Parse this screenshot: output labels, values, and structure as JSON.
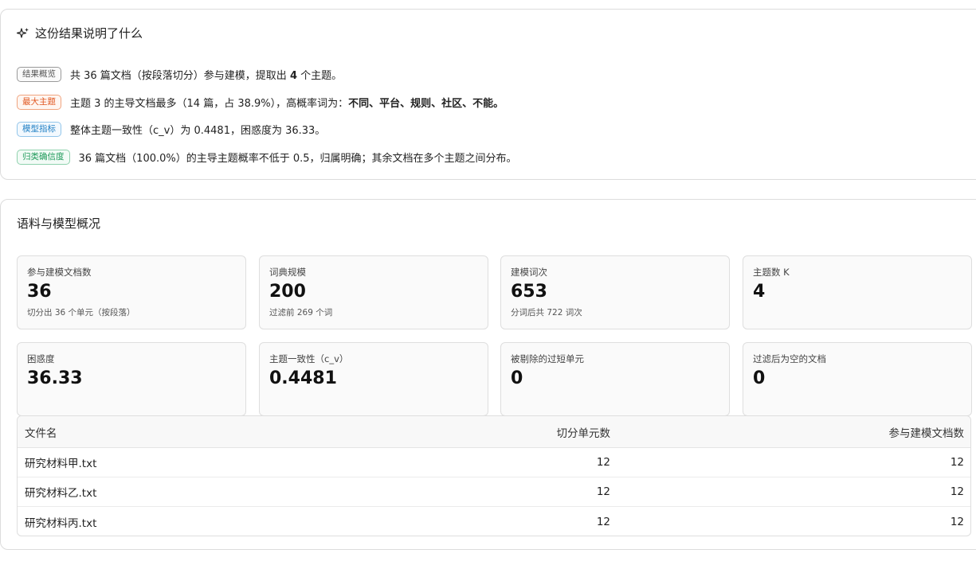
{
  "summary": {
    "title": "这份结果说明了什么",
    "icon": "sparkle-icon",
    "lines": [
      {
        "badge": "结果概览",
        "text_a": "共 36 篇文档（按段落切分）参与建模，提取出 ",
        "bold": "4",
        "text_b": " 个主题。"
      },
      {
        "badge": "最大主题",
        "text_a": "主题 3 的主导文档最多（14 篇，占 38.9%），高概率词为：",
        "bold": "不同、平台、规则、社区、不能。",
        "text_b": ""
      },
      {
        "badge": "模型指标",
        "text_a": "整体主题一致性（c_v）为 0.4481，困惑度为 36.33。",
        "bold": "",
        "text_b": ""
      },
      {
        "badge": "归类确信度",
        "text_a": "36 篇文档（100.0%）的主导主题概率不低于 0.5，归属明确；其余文档在多个主题之间分布。",
        "bold": "",
        "text_b": ""
      }
    ]
  },
  "overview": {
    "title": "语料与模型概况",
    "metrics": [
      {
        "label": "参与建模文档数",
        "value": "36",
        "sub": "切分出 36 个单元（按段落）"
      },
      {
        "label": "词典规模",
        "value": "200",
        "sub": "过滤前 269 个词"
      },
      {
        "label": "建模词次",
        "value": "653",
        "sub": "分词后共 722 词次"
      },
      {
        "label": "主题数 K",
        "value": "4",
        "sub": ""
      },
      {
        "label": "困惑度",
        "value": "36.33",
        "sub": ""
      },
      {
        "label": "主题一致性（c_v）",
        "value": "0.4481",
        "sub": ""
      },
      {
        "label": "被剔除的过短单元",
        "value": "0",
        "sub": ""
      },
      {
        "label": "过滤后为空的文档",
        "value": "0",
        "sub": ""
      }
    ],
    "table": {
      "headers": [
        "文件名",
        "切分单元数",
        "参与建模文档数"
      ],
      "rows": [
        [
          "研究材料甲.txt",
          "12",
          "12"
        ],
        [
          "研究材料乙.txt",
          "12",
          "12"
        ],
        [
          "研究材料丙.txt",
          "12",
          "12"
        ]
      ]
    }
  }
}
